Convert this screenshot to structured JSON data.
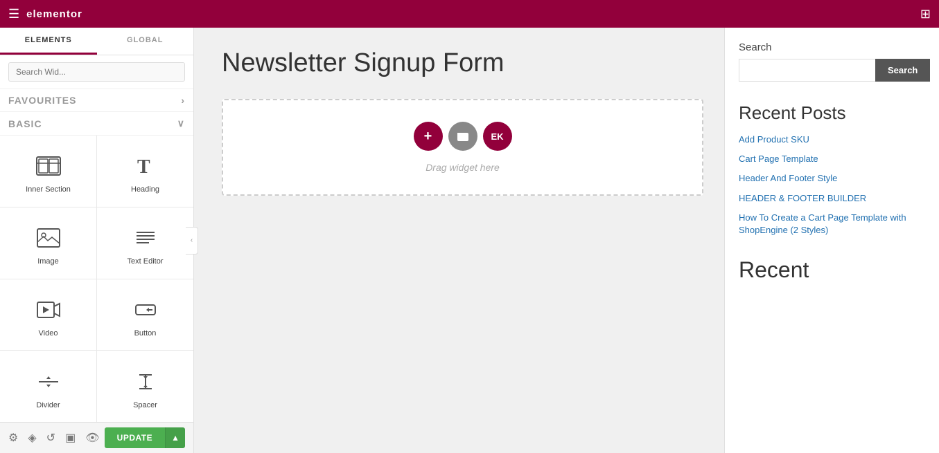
{
  "topbar": {
    "logo": "elementor",
    "hamburger_icon": "☰",
    "apps_icon": "⊞"
  },
  "sidebar": {
    "tabs": [
      {
        "id": "elements",
        "label": "ELEMENTS",
        "active": true
      },
      {
        "id": "global",
        "label": "GLOBAL",
        "active": false
      }
    ],
    "search_placeholder": "Search Wid...",
    "sections": [
      {
        "id": "favourites",
        "label": "FAVOURITES",
        "chevron": "›"
      },
      {
        "id": "basic",
        "label": "BASIC",
        "chevron": "∨"
      }
    ],
    "widgets": [
      {
        "id": "inner-section",
        "label": "Inner Section",
        "icon": "inner-section-icon"
      },
      {
        "id": "heading",
        "label": "Heading",
        "icon": "heading-icon"
      },
      {
        "id": "image",
        "label": "Image",
        "icon": "image-icon"
      },
      {
        "id": "text-editor",
        "label": "Text Editor",
        "icon": "text-editor-icon"
      },
      {
        "id": "video",
        "label": "Video",
        "icon": "video-icon"
      },
      {
        "id": "button",
        "label": "Button",
        "icon": "button-icon"
      },
      {
        "id": "divider",
        "label": "Divider",
        "icon": "divider-icon"
      },
      {
        "id": "spacer",
        "label": "Spacer",
        "icon": "spacer-icon"
      }
    ],
    "footer_icons": [
      "settings-icon",
      "layers-icon",
      "history-icon",
      "responsive-icon",
      "eye-icon"
    ],
    "update_label": "UPDATE"
  },
  "main": {
    "page_title": "Newsletter Signup Form",
    "drop_hint": "Drag widget here",
    "add_btn": "+",
    "folder_btn": "⬤",
    "ek_btn": "EK"
  },
  "right_panel": {
    "search_label": "Search",
    "search_placeholder": "",
    "search_btn_label": "Search",
    "recent_posts_title": "Recent Posts",
    "recent_posts": [
      {
        "label": "Add Product SKU",
        "url": "#"
      },
      {
        "label": "Cart Page Template",
        "url": "#"
      },
      {
        "label": "Header And Footer Style",
        "url": "#"
      },
      {
        "label": "HEADER & FOOTER BUILDER",
        "url": "#"
      },
      {
        "label": "How To Create a Cart Page Template with ShopEngine (2 Styles)",
        "url": "#"
      }
    ],
    "recent_title": "Recent"
  }
}
